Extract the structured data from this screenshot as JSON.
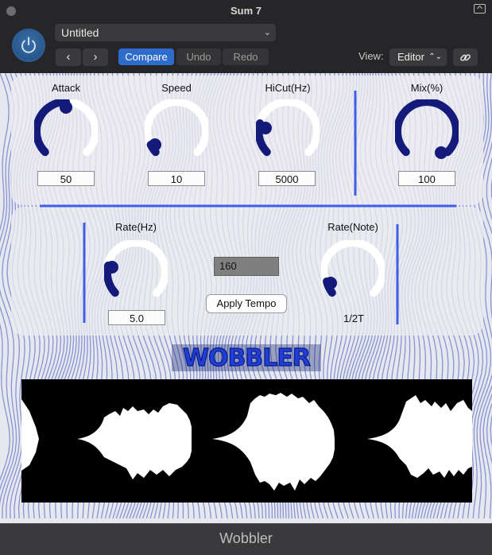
{
  "window": {
    "title": "Sum 7"
  },
  "host": {
    "preset_name": "Untitled",
    "compare_label": "Compare",
    "undo_label": "Undo",
    "redo_label": "Redo",
    "view_label": "View:",
    "view_value": "Editor",
    "icons": [
      "power-icon",
      "chevron-left-icon",
      "chevron-right-icon",
      "link-icon",
      "restore-icon"
    ]
  },
  "plugin": {
    "knobs_top": [
      {
        "label": "Attack",
        "value": "50"
      },
      {
        "label": "Speed",
        "value": "10"
      },
      {
        "label": "HiCut(Hz)",
        "value": "5000"
      },
      {
        "label": "Mix(%)",
        "value": "100"
      }
    ],
    "knobs_bottom": [
      {
        "label": "Rate(Hz)",
        "value": "5.0"
      },
      {
        "label": "Rate(Note)",
        "value": "1/2T"
      }
    ],
    "tempo_value": "160",
    "apply_tempo_label": "Apply Tempo",
    "logo": "WOBBLER",
    "colors": {
      "knob_track": "#141a7a",
      "divider": "#3e5ee6",
      "accent": "#2d6bcd"
    }
  },
  "footer": {
    "title": "Wobbler"
  }
}
